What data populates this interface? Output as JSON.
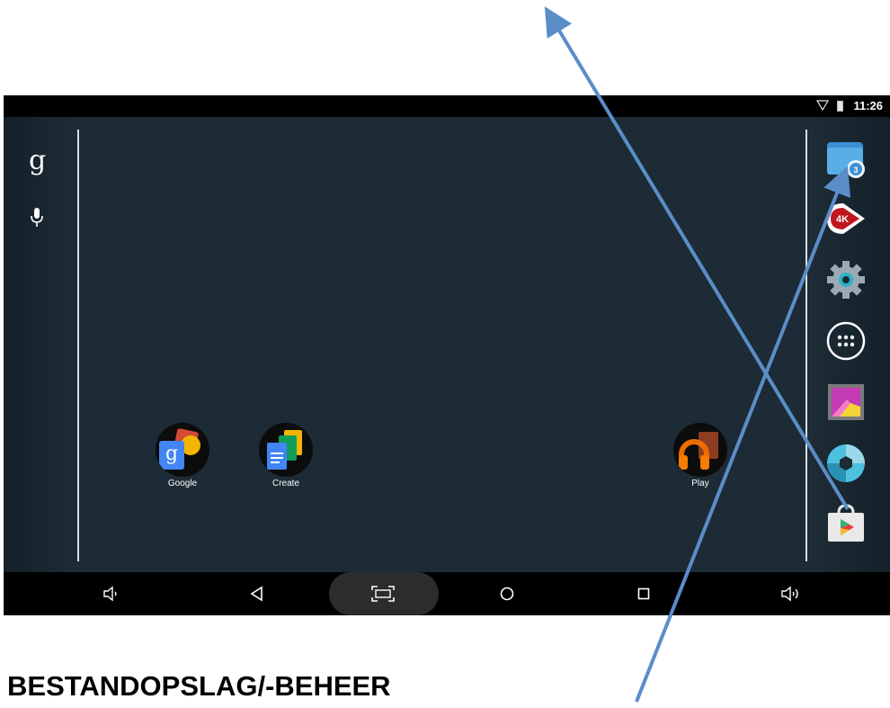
{
  "status_bar": {
    "time": "11:26",
    "wifi_icon": "wifi-outline-icon",
    "battery_icon": "battery-icon"
  },
  "search_panel": {
    "google_letter": "g",
    "mic_icon": "microphone-icon"
  },
  "home": {
    "apps": [
      {
        "label": "Google",
        "icon": "google-folder-icon"
      },
      {
        "label": "Create",
        "icon": "docs-folder-icon"
      },
      {
        "label": "Play",
        "icon": "play-music-folder-icon"
      }
    ]
  },
  "dock": {
    "items": [
      {
        "icon": "file-manager-icon"
      },
      {
        "icon": "4k-player-icon",
        "text": "4K"
      },
      {
        "icon": "settings-gear-icon"
      },
      {
        "icon": "app-drawer-icon"
      },
      {
        "icon": "gallery-icon"
      },
      {
        "icon": "camera-aperture-icon"
      },
      {
        "icon": "play-store-icon"
      }
    ]
  },
  "nav_bar": {
    "buttons": [
      "volume-down-icon",
      "back-icon",
      "screenshot-icon",
      "home-icon",
      "recents-icon",
      "volume-up-icon"
    ]
  },
  "caption": "BESTANDOPSLAG/-BEHEER",
  "colors": {
    "arrow": "#5b8dc7",
    "screen_bg": "#1c2b35",
    "nav_bg": "#000000"
  }
}
